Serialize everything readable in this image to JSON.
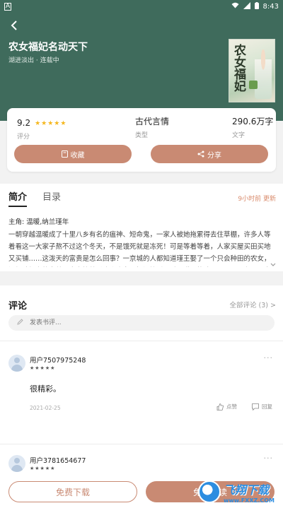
{
  "status_bar": {
    "left_indicator": "A",
    "time": "8:43"
  },
  "book": {
    "title": "农女福妃名动天下",
    "author": "湖进淡出",
    "status": "连载中",
    "meta_separator": "·",
    "cover_text": "农女福妃"
  },
  "stats": {
    "rating": {
      "value": "9.2",
      "stars": "★★★★★",
      "label": "评分"
    },
    "category": {
      "value": "古代言情",
      "label": "类型"
    },
    "words": {
      "value": "290.6万字",
      "label": "文字"
    }
  },
  "actions": {
    "collect_label": "收藏",
    "share_label": "分享"
  },
  "intro": {
    "tabs": [
      {
        "label": "简介",
        "active": true
      },
      {
        "label": "目录",
        "active": false
      }
    ],
    "update_time": "9小时前 更新",
    "protagonist": "主角: 温暖,纳兰瑾年",
    "synopsis": "一朝穿越温暖成了十里八乡有名的瘟神、短命鬼，一家人被她拖累得去住草棚，许多人等着看这一大家子熬不过这个冬天，不是饿死就是冻死！可是等着等着，人家买屋买田买地又买铺……这泼天的富贵是怎么回事？一京城的人都知道瑾王娶了一个只会种田的农女，还如珠如宝的宠着，大家等着看这个农女王妃闹笑话，丢尽瑾王的脸子！可是，有一天大家发...",
    "expand_icon": "chevron-down-icon"
  },
  "comments": {
    "title": "评论",
    "all_label": "全部评论 (3)",
    "all_chevron": ">",
    "input_placeholder": "发表书评...",
    "items": [
      {
        "username": "用户7507975248",
        "stars": "★★★★★",
        "more": "···",
        "text": "很精彩。",
        "date": "2021-02-25",
        "like_label": "点赞",
        "reply_label": "回复"
      },
      {
        "username": "用户3781654677",
        "stars": "★★★★★",
        "more": "···"
      }
    ]
  },
  "bottom_bar": {
    "free_download_label": "免费下载",
    "read_label": "免费阅读"
  },
  "watermark": {
    "name": "飞翔下载",
    "url": "www.FXXZ.COM"
  },
  "colors": {
    "header": "#3f6b5c",
    "accent": "#c98a73",
    "stars": "#f5b71e",
    "update_time": "#d98b6c"
  }
}
